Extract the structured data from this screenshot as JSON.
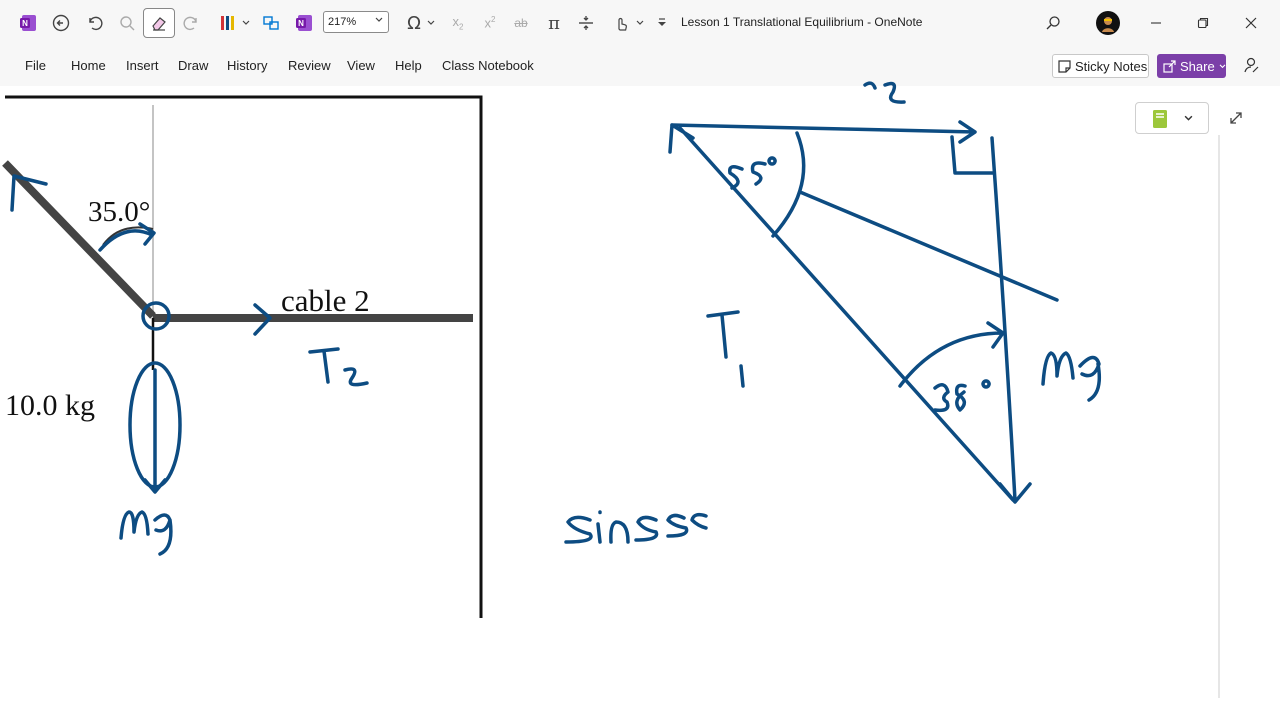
{
  "titlebar": {
    "zoom": "217%",
    "title": "Lesson 1 Translational Equilibrium  -  OneNote",
    "quick_access_icons": [
      "onenote-logo-icon",
      "back-icon",
      "undo-icon",
      "search-ink-icon",
      "eraser-icon",
      "redo-icon",
      "pens-icon",
      "ink-to-shape-icon",
      "onenote-icon",
      "omega-symbol-icon",
      "subscript-icon",
      "superscript-icon",
      "strikethrough-icon",
      "pi-equation-icon",
      "insert-space-icon",
      "touch-drawing-icon",
      "customize-icon"
    ]
  },
  "menu": {
    "items": [
      "File",
      "Home",
      "Insert",
      "Draw",
      "History",
      "Review",
      "View",
      "Help",
      "Class Notebook"
    ],
    "sticky_notes": "Sticky Notes",
    "share": "Share"
  },
  "diagram": {
    "angle_label": "35.0°",
    "cable_label": "cable 2",
    "mass_label": "10.0 kg"
  },
  "colors": {
    "ink": "#0d4c82",
    "brand": "#7719aa",
    "share_bg": "#7b3fa8"
  }
}
